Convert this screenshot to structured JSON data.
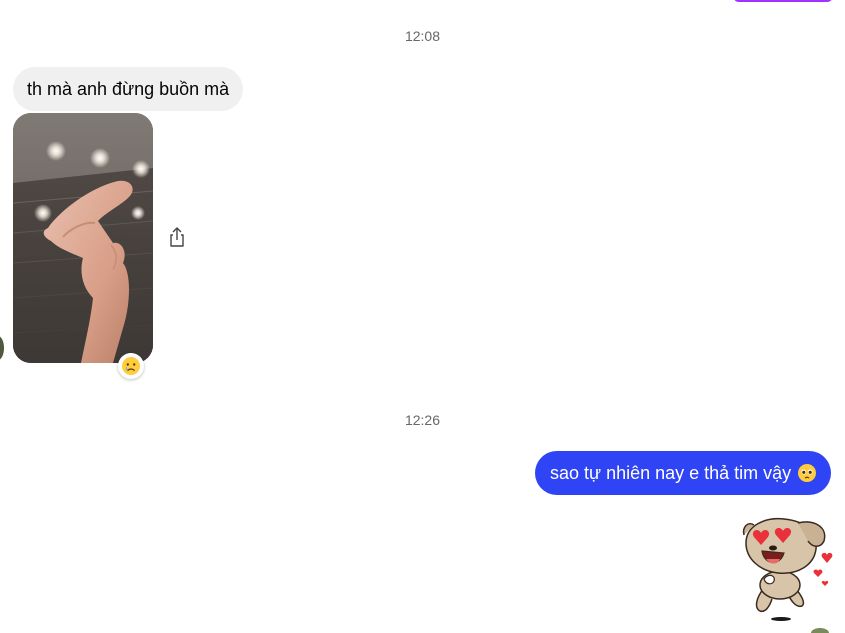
{
  "messages": {
    "timestamp_1": "12:08",
    "incoming_text": "th mà anh đừng buồn mà",
    "reaction_icon": "crying-face-emoji",
    "share_icon": "share-icon",
    "timestamp_2": "12:26",
    "outgoing_text": "sao tự nhiên nay e thả tim vậy",
    "outgoing_emoji_icon": "pleading-face-emoji",
    "sticker_icon": "heart-eyes-dog-sticker"
  },
  "colors": {
    "outgoing_bubble": "#2f44f5",
    "incoming_bubble": "#f0f0f0",
    "timestamp_text": "#65676b",
    "previous_outgoing_bubble": "#a033ff"
  }
}
